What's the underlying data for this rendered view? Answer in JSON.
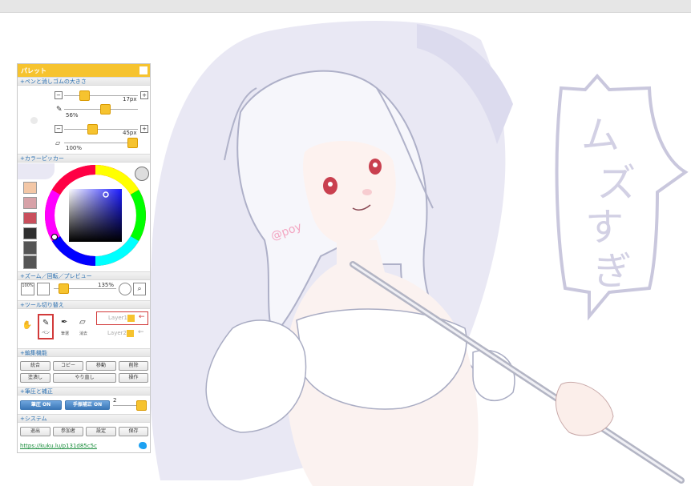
{
  "palette": {
    "title": "パレット",
    "sections": {
      "pen_size": "+ペンと消しゴムの大きさ",
      "color_picker": "+カラーピッカー",
      "zoom": "+ズーム／回転／プレビュー",
      "tool": "+ツール切り替え",
      "edit": "+編集機能",
      "pressure": "+筆圧と補正",
      "system": "+システム"
    },
    "pen": {
      "size": "17px",
      "opacity": "56%"
    },
    "eraser": {
      "size": "45px",
      "opacity": "100%"
    },
    "swatch_colors": [
      "#f3c7a6",
      "#d7a2a8",
      "#c94f5c",
      "#2f2f2f"
    ],
    "zoom": {
      "fit_label": "100%",
      "value": "135%"
    },
    "tools": {
      "pen": "ペン",
      "dropper": "筆選",
      "eraser": "消去"
    },
    "layers": [
      "Layer1",
      "Layer2"
    ],
    "edit_buttons": {
      "merge": "統合",
      "copy": "コピー",
      "move": "移動",
      "delete": "削除",
      "fill": "塗潰し",
      "redo": "やり直し",
      "operate": "操作"
    },
    "pressure": {
      "pen_pressure": "筆圧 ON",
      "stabilizer": "手振補正 ON",
      "level": "2"
    },
    "system_buttons": {
      "exit": "退出",
      "participants": "参加者",
      "settings": "設定",
      "save": "保存"
    },
    "url": "https://kuku.lu/p131d85c5c",
    "accent": "#f6c32f"
  },
  "canvas": {
    "speech_text": "ムズすぎ",
    "signature": "@poy"
  }
}
